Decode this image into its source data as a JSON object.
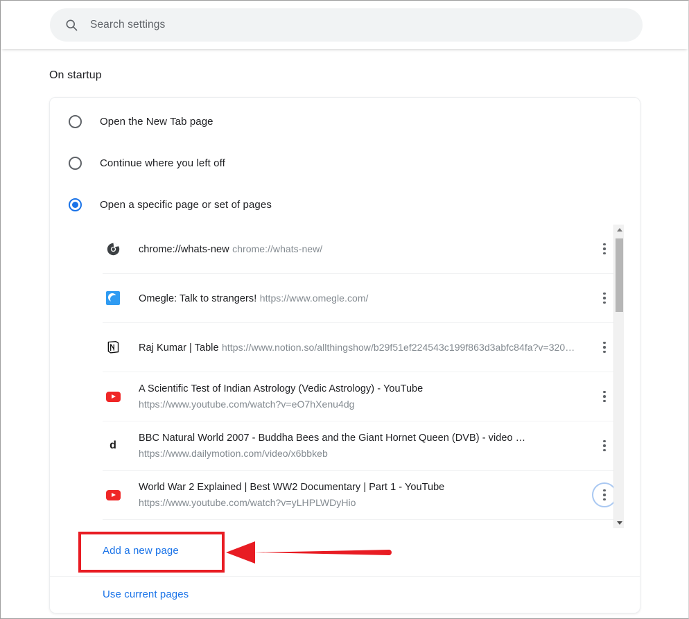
{
  "search": {
    "placeholder": "Search settings",
    "icon": "search-icon"
  },
  "section": {
    "title": "On startup"
  },
  "startup_options": [
    {
      "label": "Open the New Tab page",
      "selected": false
    },
    {
      "label": "Continue where you left off",
      "selected": false
    },
    {
      "label": "Open a specific page or set of pages",
      "selected": true
    }
  ],
  "pages": [
    {
      "title": "chrome://whats-new",
      "url": "chrome://whats-new/",
      "favicon": "chrome-icon",
      "menu_focused": false
    },
    {
      "title": "Omegle: Talk to strangers!",
      "url": "https://www.omegle.com/",
      "favicon": "omegle-icon",
      "menu_focused": false
    },
    {
      "title": "Raj Kumar | Table",
      "url": "https://www.notion.so/allthingshow/b29f51ef224543c199f863d3abfc84fa?v=320…",
      "favicon": "notion-icon",
      "menu_focused": false
    },
    {
      "title": "A Scientific Test of Indian Astrology (Vedic Astrology) - YouTube",
      "url": "https://www.youtube.com/watch?v=eO7hXenu4dg",
      "favicon": "youtube-icon",
      "menu_focused": false
    },
    {
      "title": "BBC Natural World 2007 - Buddha Bees and the Giant Hornet Queen (DVB) - video …",
      "url": "https://www.dailymotion.com/video/x6bbkeb",
      "favicon": "dailymotion-icon",
      "menu_focused": false
    },
    {
      "title": "World War 2 Explained | Best WW2 Documentary | Part 1 - YouTube",
      "url": "https://www.youtube.com/watch?v=yLHPLWDyHio",
      "favicon": "youtube-icon",
      "menu_focused": true
    }
  ],
  "actions": {
    "add_page": "Add a new page",
    "use_current_pages": "Use current pages"
  },
  "colors": {
    "accent": "#1a73e8",
    "annotation": "#e81c23",
    "focus_ring": "#a9c8f2",
    "text_primary": "#202124",
    "text_secondary": "#838a90"
  }
}
